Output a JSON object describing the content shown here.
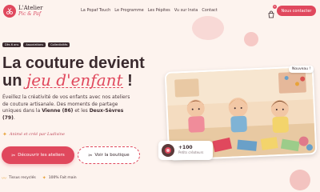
{
  "header": {
    "logo": {
      "line1": "L'Atelier",
      "line2": "Pic & Paf",
      "icon": "scissors-icon"
    },
    "nav": [
      "La Popaf Touch",
      "Le Programme",
      "Les Pépites",
      "Vu sur Insta",
      "Contact"
    ],
    "cart": {
      "icon": "shopping-bag-icon",
      "count": "0"
    },
    "contact_button": "Nous contacter"
  },
  "hero": {
    "tags": [
      "Dès 6 ans",
      "Associations",
      "Collectivités"
    ],
    "title_line1": "La couture devient",
    "title_line2_prefix": "un",
    "title_line2_accent": "jeu d'enfant",
    "title_line2_suffix": "!",
    "description_start": "Éveillez la créativité de vos enfants avec nos ateliers de couture artisanale. Des moments de partage uniques dans la",
    "description_region1": "Vienne (86)",
    "description_mid": "et les",
    "description_region2": "Deux-Sèvres (79)",
    "description_end": ".",
    "signature": "Animé et créé par Ludivine",
    "primary_button": "Découvrir les ateliers",
    "secondary_button": "Voir la boutique",
    "features": [
      {
        "icon": "fabric-icon",
        "label": "Tissus recyclés"
      },
      {
        "icon": "sparkle-icon",
        "label": "100% Fait main"
      }
    ]
  },
  "image_card": {
    "badge": "Nouveau !",
    "stat_value": "+100",
    "stat_label": "Petits créateurs"
  },
  "colors": {
    "accent": "#e0485d",
    "text": "#3a2a2e",
    "background": "#fdf3ee"
  }
}
